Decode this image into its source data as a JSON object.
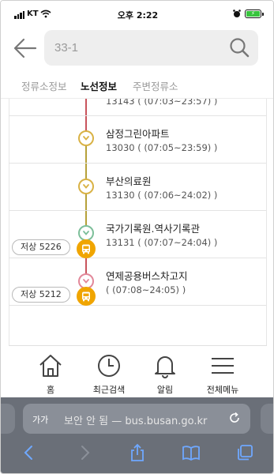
{
  "status_bar": {
    "carrier": "KT",
    "time": "오후 2:22",
    "battery_color": "#37c43d"
  },
  "header": {
    "search_value": "33-1",
    "icons": {
      "back": "arrow-left-icon",
      "search": "magnifier-icon"
    }
  },
  "tabs": [
    {
      "label": "정류소정보",
      "active": false
    },
    {
      "label": "노선정보",
      "active": true
    },
    {
      "label": "주변정류소",
      "active": false
    }
  ],
  "stops": [
    {
      "name": "",
      "sub": "13143 ( (07:03~23:57) )"
    },
    {
      "name": "삼정그린아파트",
      "sub": "13030 ( (07:05~23:59) )"
    },
    {
      "name": "부산의료원",
      "sub": "13130 ( (07:06~24:02) )"
    },
    {
      "name": "국가기록원.역사기록관",
      "sub": "13131 ( (07:07~24:04) )"
    },
    {
      "name": "연제공용버스차고지",
      "sub": "( (07:08~24:05) )"
    }
  ],
  "buses": [
    {
      "plate": "저상 5226"
    },
    {
      "plate": "저상 5212"
    }
  ],
  "colors": {
    "line_red": "#c9545c",
    "line_olive": "#b6a13a",
    "node_yellow": "#d9b245",
    "node_green": "#7dbf9a",
    "node_pink": "#e2889a",
    "bus_orange": "#f0a500"
  },
  "bottom_nav": [
    {
      "label": "홈",
      "icon": "home-icon"
    },
    {
      "label": "최근검색",
      "icon": "clock-icon"
    },
    {
      "label": "알림",
      "icon": "bell-icon"
    },
    {
      "label": "전체메뉴",
      "icon": "menu-icon"
    }
  ],
  "browser": {
    "text_size_label": "가가",
    "url_text": "보안 안 됨 — bus.busan.go.kr",
    "icons": [
      "back-icon",
      "forward-icon",
      "share-icon",
      "bookmarks-icon",
      "tabs-icon"
    ]
  }
}
